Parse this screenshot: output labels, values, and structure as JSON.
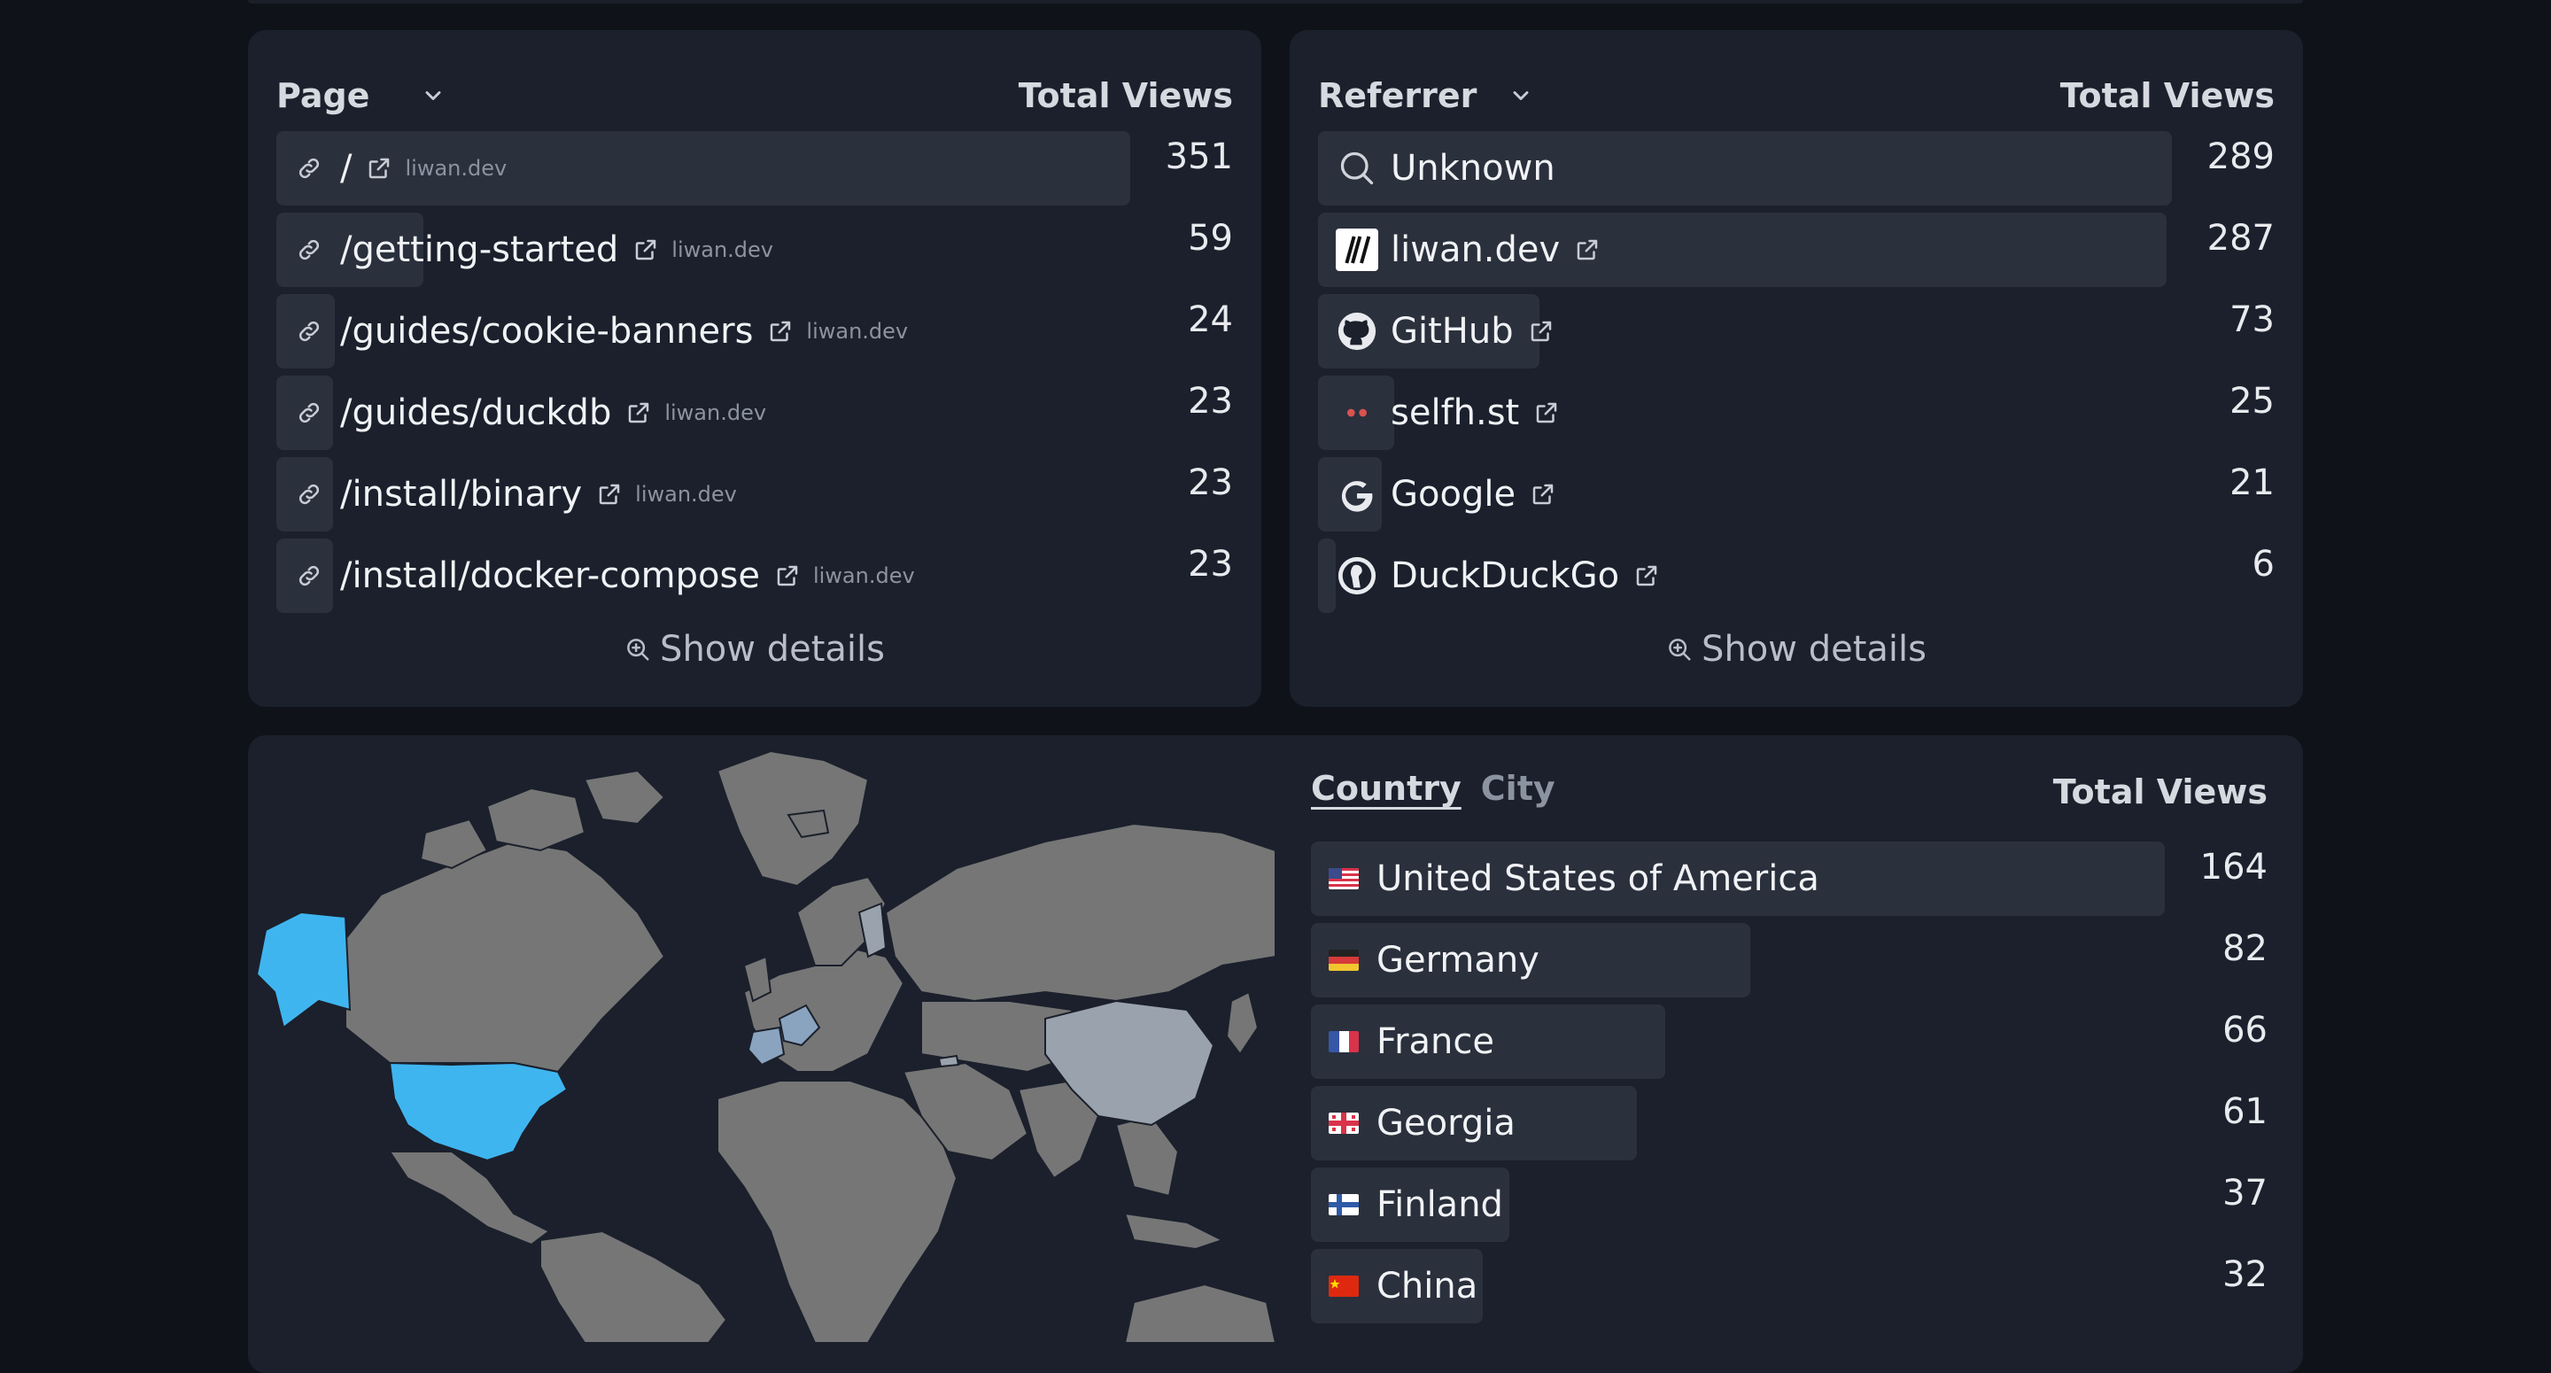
{
  "pages": {
    "title": "Page",
    "metric": "Total Views",
    "rows": [
      {
        "label": "/",
        "domain": "liwan.dev",
        "views": "351",
        "pct": 0.893
      },
      {
        "label": "/getting-started",
        "domain": "liwan.dev",
        "views": "59",
        "pct": 0.15
      },
      {
        "label": "/guides/cookie-banners",
        "domain": "liwan.dev",
        "views": "24",
        "pct": 0.061
      },
      {
        "label": "/guides/duckdb",
        "domain": "liwan.dev",
        "views": "23",
        "pct": 0.059
      },
      {
        "label": "/install/binary",
        "domain": "liwan.dev",
        "views": "23",
        "pct": 0.059
      },
      {
        "label": "/install/docker-compose",
        "domain": "liwan.dev",
        "views": "23",
        "pct": 0.059
      }
    ],
    "show_details": "Show details"
  },
  "referrers": {
    "title": "Referrer",
    "metric": "Total Views",
    "rows": [
      {
        "label": "Unknown",
        "icon": "search-icon",
        "views": "289",
        "pct": 0.893,
        "external": false
      },
      {
        "label": "liwan.dev",
        "icon": "liwan-logo-icon",
        "views": "287",
        "pct": 0.887,
        "external": true
      },
      {
        "label": "GitHub",
        "icon": "github-icon",
        "views": "73",
        "pct": 0.226,
        "external": true
      },
      {
        "label": "selfh.st",
        "icon": "selfhst-icon",
        "views": "25",
        "pct": 0.077,
        "external": true
      },
      {
        "label": "Google",
        "icon": "google-icon",
        "views": "21",
        "pct": 0.065,
        "external": true
      },
      {
        "label": "DuckDuckGo",
        "icon": "duckduckgo-icon",
        "views": "6",
        "pct": 0.019,
        "external": true
      }
    ],
    "show_details": "Show details"
  },
  "geo": {
    "tabs": [
      "Country",
      "City"
    ],
    "active_tab": "Country",
    "metric": "Total Views",
    "highlight_color": "#3fb5f0",
    "rows": [
      {
        "label": "United States of America",
        "flag": "us-flag",
        "views": "164",
        "pct": 0.893
      },
      {
        "label": "Germany",
        "flag": "de-flag",
        "views": "82",
        "pct": 0.446
      },
      {
        "label": "France",
        "flag": "fr-flag",
        "views": "66",
        "pct": 0.359
      },
      {
        "label": "Georgia",
        "flag": "ge-flag",
        "views": "61",
        "pct": 0.332
      },
      {
        "label": "Finland",
        "flag": "fi-flag",
        "views": "37",
        "pct": 0.201
      },
      {
        "label": "China",
        "flag": "cn-flag",
        "views": "32",
        "pct": 0.174
      }
    ]
  }
}
